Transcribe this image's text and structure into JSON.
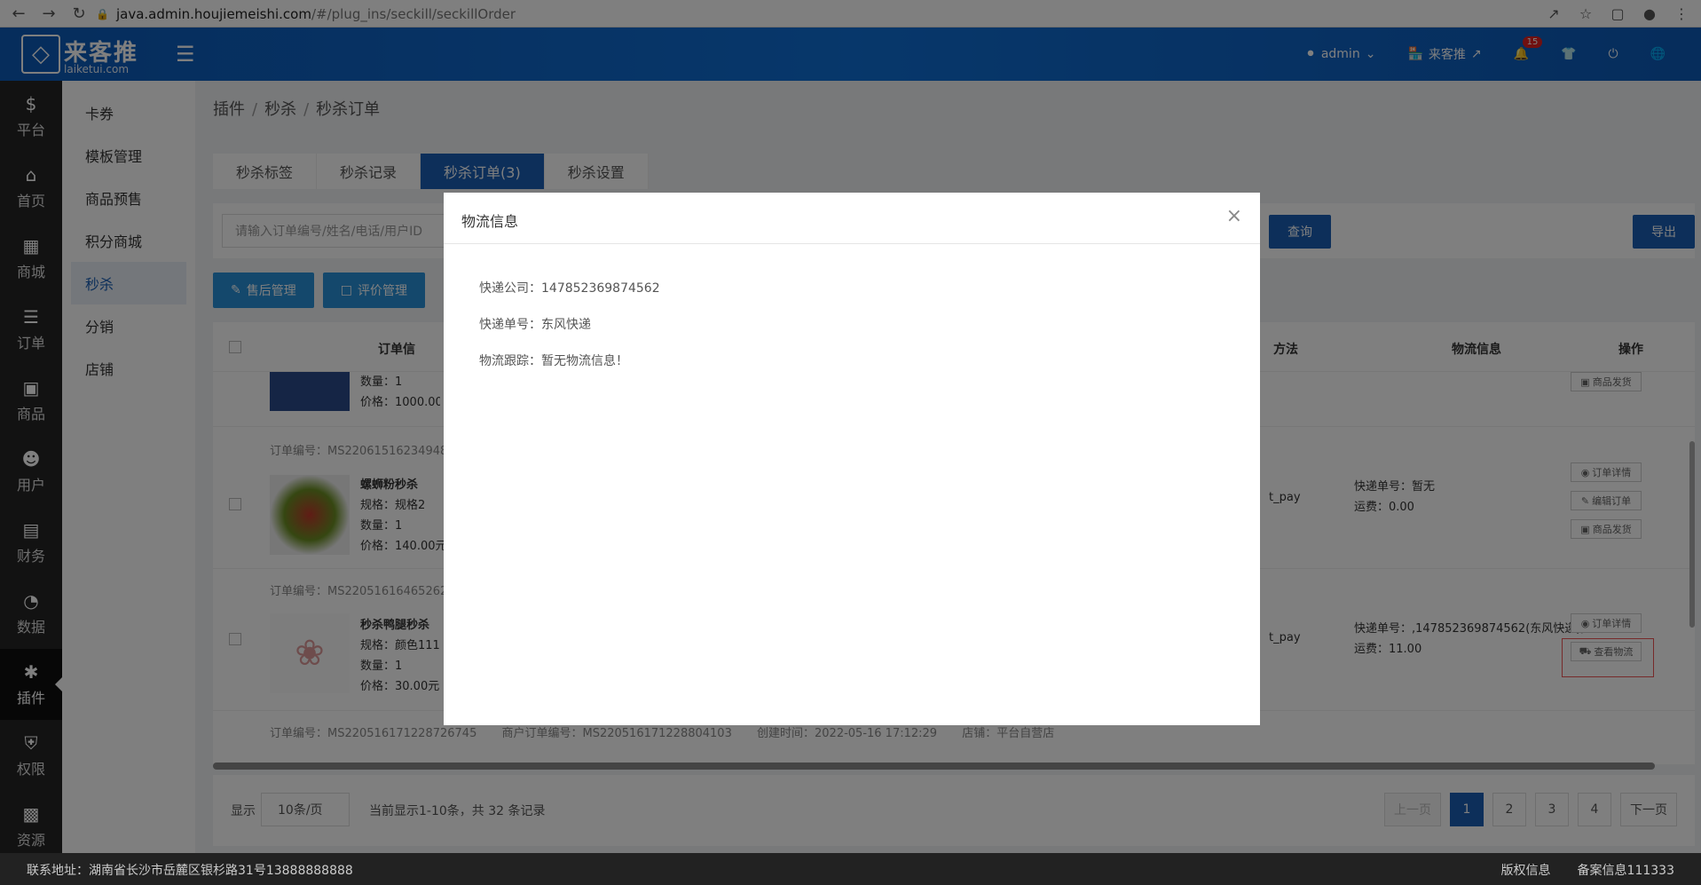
{
  "browser": {
    "url_host": "java.admin.houjiemeishi.com",
    "url_path": "/#/plug_ins/seckill/seckillOrder"
  },
  "header": {
    "logo_title": "来客推",
    "logo_sub": "laiketui.com",
    "admin_label": "admin",
    "store_label": "来客推",
    "notif_count": "15"
  },
  "leftnav": [
    {
      "label": "平台",
      "icon": "platform-icon"
    },
    {
      "label": "首页",
      "icon": "home-icon"
    },
    {
      "label": "商城",
      "icon": "mall-icon"
    },
    {
      "label": "订单",
      "icon": "order-icon"
    },
    {
      "label": "商品",
      "icon": "goods-icon"
    },
    {
      "label": "用户",
      "icon": "user-icon"
    },
    {
      "label": "财务",
      "icon": "wallet-icon"
    },
    {
      "label": "数据",
      "icon": "pie-chart-icon"
    },
    {
      "label": "插件",
      "icon": "puzzle-icon"
    },
    {
      "label": "权限",
      "icon": "shield-icon"
    },
    {
      "label": "资源",
      "icon": "image-icon"
    }
  ],
  "subnav": [
    "卡券",
    "模板管理",
    "商品预售",
    "积分商城",
    "秒杀",
    "分销",
    "店铺"
  ],
  "breadcrumb": [
    "插件",
    "秒杀",
    "秒杀订单"
  ],
  "tabs": [
    "秒杀标签",
    "秒杀记录",
    "秒杀订单(3)",
    "秒杀设置"
  ],
  "search": {
    "placeholder": "请输入订单编号/姓名/电话/用户ID",
    "query_label": "查询",
    "export_label": "导出"
  },
  "actions": {
    "after_sale": "售后管理",
    "review": "评价管理"
  },
  "table": {
    "headers": {
      "order": "订单信",
      "pay": "方法",
      "logistics": "物流信息",
      "ops": "操作"
    },
    "row0": {
      "qty": "数量：1",
      "price": "价格：1000.00",
      "op_ship": "商品发货"
    },
    "row1": {
      "order_no": "订单编号：MS22061516234948",
      "name": "螺蛳粉秒杀",
      "spec": "规格：规格2",
      "qty": "数量：1",
      "price": "价格：140.00元",
      "pay": "t_pay",
      "log_no": "快递单号：暂无",
      "freight": "运费：0.00",
      "op_detail": "订单详情",
      "op_edit": "编辑订单",
      "op_ship": "商品发货"
    },
    "row2": {
      "order_no": "订单编号：MS22051616465262",
      "name": "秒杀鸭腿秒杀",
      "spec": "规格：颜色111",
      "qty": "数量：1",
      "price": "价格：30.00元",
      "pay": "t_pay",
      "log_no": "快递单号：,147852369874562(东风快递),",
      "freight": "运费：11.00",
      "op_detail": "订单详情",
      "op_logistics": "查看物流"
    },
    "row3": {
      "order_no": "订单编号：MS220516171228726745",
      "merchant_no": "商户订单编号：MS220516171228804103",
      "created": "创建时间：2022-05-16 17:12:29",
      "store": "店铺：平台自营店"
    }
  },
  "pager": {
    "show": "显示",
    "page_size": "10条/页",
    "info": "当前显示1-10条，共 32 条记录",
    "prev": "上一页",
    "pages": [
      "1",
      "2",
      "3",
      "4"
    ],
    "next": "下一页"
  },
  "footer": {
    "address": "联系地址：湖南省长沙市岳麓区银杉路31号13888888888",
    "copyright": "版权信息",
    "icp": "备案信息111333"
  },
  "modal": {
    "title": "物流信息",
    "company": "快递公司：147852369874562",
    "tracking_no": "快递单号：东风快递",
    "trace": "物流跟踪：暂无物流信息！"
  },
  "colors": {
    "primary": "#1a5fb4",
    "topbar": "#0f6fd6",
    "sidebar": "#242424",
    "badge": "#e02020"
  }
}
